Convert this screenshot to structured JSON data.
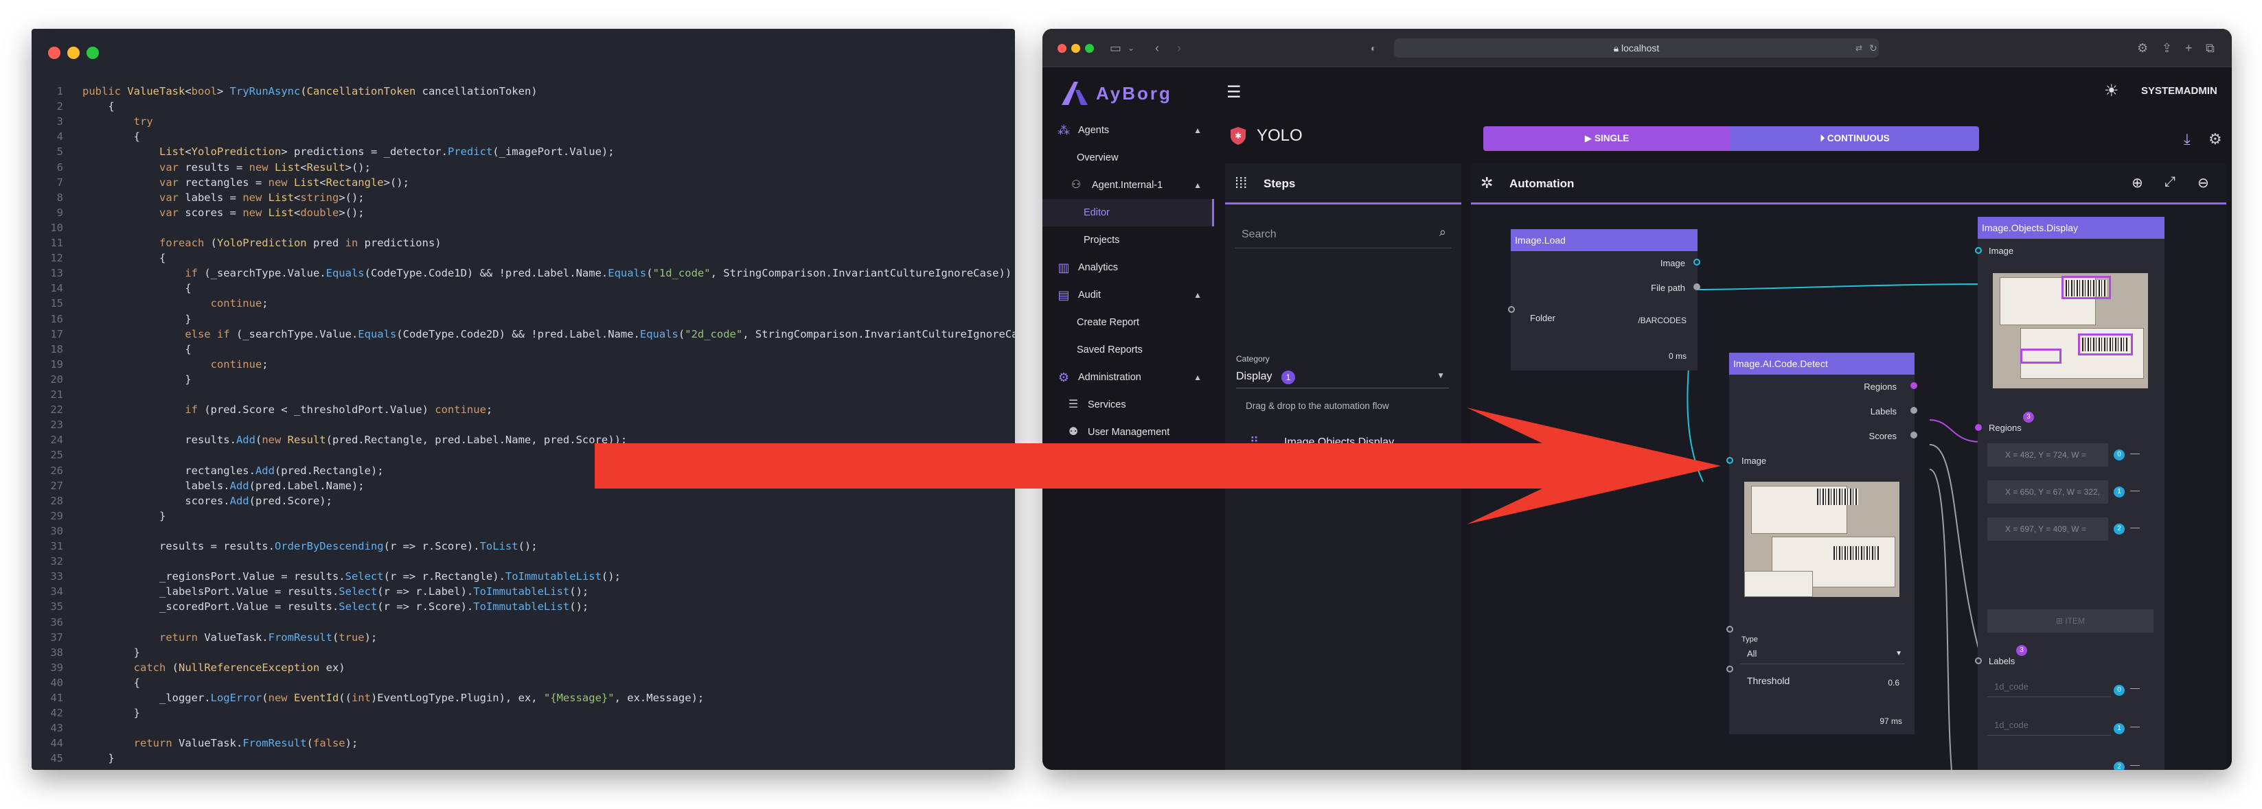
{
  "code": {
    "lines": [
      {
        "n": "1",
        "indent": 0,
        "parts": [
          [
            "kw",
            "public "
          ],
          [
            "ty",
            "ValueTask"
          ],
          [
            "tx",
            "<"
          ],
          [
            "kw",
            "bool"
          ],
          [
            "tx",
            "> "
          ],
          [
            "fn",
            "TryRunAsync"
          ],
          [
            "tx",
            "("
          ],
          [
            "ty",
            "CancellationToken"
          ],
          [
            "tx",
            " cancellationToken)"
          ]
        ]
      },
      {
        "n": "2",
        "indent": 1,
        "parts": [
          [
            "tx",
            "{"
          ]
        ]
      },
      {
        "n": "3",
        "indent": 2,
        "parts": [
          [
            "kw",
            "try"
          ]
        ]
      },
      {
        "n": "4",
        "indent": 2,
        "parts": [
          [
            "tx",
            "{"
          ]
        ]
      },
      {
        "n": "5",
        "indent": 3,
        "parts": [
          [
            "ty",
            "List"
          ],
          [
            "tx",
            "<"
          ],
          [
            "ty",
            "YoloPrediction"
          ],
          [
            "tx",
            "> predictions = _detector."
          ],
          [
            "fn",
            "Predict"
          ],
          [
            "tx",
            "(_imagePort.Value);"
          ]
        ]
      },
      {
        "n": "6",
        "indent": 3,
        "parts": [
          [
            "kw",
            "var"
          ],
          [
            "tx",
            " results = "
          ],
          [
            "kw",
            "new "
          ],
          [
            "ty",
            "List"
          ],
          [
            "tx",
            "<"
          ],
          [
            "ty",
            "Result"
          ],
          [
            "tx",
            ">();"
          ]
        ]
      },
      {
        "n": "7",
        "indent": 3,
        "parts": [
          [
            "kw",
            "var"
          ],
          [
            "tx",
            " rectangles = "
          ],
          [
            "kw",
            "new "
          ],
          [
            "ty",
            "List"
          ],
          [
            "tx",
            "<"
          ],
          [
            "ty",
            "Rectangle"
          ],
          [
            "tx",
            ">();"
          ]
        ]
      },
      {
        "n": "8",
        "indent": 3,
        "parts": [
          [
            "kw",
            "var"
          ],
          [
            "tx",
            " labels = "
          ],
          [
            "kw",
            "new "
          ],
          [
            "ty",
            "List"
          ],
          [
            "tx",
            "<"
          ],
          [
            "kw",
            "string"
          ],
          [
            "tx",
            ">();"
          ]
        ]
      },
      {
        "n": "9",
        "indent": 3,
        "parts": [
          [
            "kw",
            "var"
          ],
          [
            "tx",
            " scores = "
          ],
          [
            "kw",
            "new "
          ],
          [
            "ty",
            "List"
          ],
          [
            "tx",
            "<"
          ],
          [
            "kw",
            "double"
          ],
          [
            "tx",
            ">();"
          ]
        ]
      },
      {
        "n": "10",
        "indent": 0,
        "parts": []
      },
      {
        "n": "11",
        "indent": 3,
        "parts": [
          [
            "kw",
            "foreach"
          ],
          [
            "tx",
            " ("
          ],
          [
            "ty",
            "YoloPrediction"
          ],
          [
            "tx",
            " pred "
          ],
          [
            "kw",
            "in"
          ],
          [
            "tx",
            " predictions)"
          ]
        ]
      },
      {
        "n": "12",
        "indent": 3,
        "parts": [
          [
            "tx",
            "{"
          ]
        ]
      },
      {
        "n": "13",
        "indent": 4,
        "parts": [
          [
            "kw",
            "if"
          ],
          [
            "tx",
            " (_searchType.Value."
          ],
          [
            "fn",
            "Equals"
          ],
          [
            "tx",
            "(CodeType.Code1D) && !pred.Label.Name."
          ],
          [
            "fn",
            "Equals"
          ],
          [
            "tx",
            "("
          ],
          [
            "str",
            "\"1d_code\""
          ],
          [
            "tx",
            ", StringComparison.InvariantCultureIgnoreCase))"
          ]
        ]
      },
      {
        "n": "14",
        "indent": 4,
        "parts": [
          [
            "tx",
            "{"
          ]
        ]
      },
      {
        "n": "15",
        "indent": 5,
        "parts": [
          [
            "kw",
            "continue"
          ],
          [
            "tx",
            ";"
          ]
        ]
      },
      {
        "n": "16",
        "indent": 4,
        "parts": [
          [
            "tx",
            "}"
          ]
        ]
      },
      {
        "n": "17",
        "indent": 4,
        "parts": [
          [
            "kw",
            "else if"
          ],
          [
            "tx",
            " (_searchType.Value."
          ],
          [
            "fn",
            "Equals"
          ],
          [
            "tx",
            "(CodeType.Code2D) && !pred.Label.Name."
          ],
          [
            "fn",
            "Equals"
          ],
          [
            "tx",
            "("
          ],
          [
            "str",
            "\"2d_code\""
          ],
          [
            "tx",
            ", StringComparison.InvariantCultureIgnoreCase))"
          ]
        ]
      },
      {
        "n": "18",
        "indent": 4,
        "parts": [
          [
            "tx",
            "{"
          ]
        ]
      },
      {
        "n": "19",
        "indent": 5,
        "parts": [
          [
            "kw",
            "continue"
          ],
          [
            "tx",
            ";"
          ]
        ]
      },
      {
        "n": "20",
        "indent": 4,
        "parts": [
          [
            "tx",
            "}"
          ]
        ]
      },
      {
        "n": "21",
        "indent": 0,
        "parts": []
      },
      {
        "n": "22",
        "indent": 4,
        "parts": [
          [
            "kw",
            "if"
          ],
          [
            "tx",
            " (pred.Score < _thresholdPort.Value) "
          ],
          [
            "kw",
            "continue"
          ],
          [
            "tx",
            ";"
          ]
        ]
      },
      {
        "n": "23",
        "indent": 0,
        "parts": []
      },
      {
        "n": "24",
        "indent": 4,
        "parts": [
          [
            "tx",
            "results."
          ],
          [
            "fn",
            "Add"
          ],
          [
            "tx",
            "("
          ],
          [
            "kw",
            "new "
          ],
          [
            "ty",
            "Result"
          ],
          [
            "tx",
            "(pred.Rectangle, pred.Label.Name, pred.Score));"
          ]
        ]
      },
      {
        "n": "25",
        "indent": 0,
        "parts": []
      },
      {
        "n": "26",
        "indent": 4,
        "parts": [
          [
            "tx",
            "rectangles."
          ],
          [
            "fn",
            "Add"
          ],
          [
            "tx",
            "(pred.Rectangle);"
          ]
        ]
      },
      {
        "n": "27",
        "indent": 4,
        "parts": [
          [
            "tx",
            "labels."
          ],
          [
            "fn",
            "Add"
          ],
          [
            "tx",
            "(pred.Label.Name);"
          ]
        ]
      },
      {
        "n": "28",
        "indent": 4,
        "parts": [
          [
            "tx",
            "scores."
          ],
          [
            "fn",
            "Add"
          ],
          [
            "tx",
            "(pred.Score);"
          ]
        ]
      },
      {
        "n": "29",
        "indent": 3,
        "parts": [
          [
            "tx",
            "}"
          ]
        ]
      },
      {
        "n": "30",
        "indent": 0,
        "parts": []
      },
      {
        "n": "31",
        "indent": 3,
        "parts": [
          [
            "tx",
            "results = results."
          ],
          [
            "fn",
            "OrderByDescending"
          ],
          [
            "tx",
            "(r => r.Score)."
          ],
          [
            "fn",
            "ToList"
          ],
          [
            "tx",
            "();"
          ]
        ]
      },
      {
        "n": "32",
        "indent": 0,
        "parts": []
      },
      {
        "n": "33",
        "indent": 3,
        "parts": [
          [
            "tx",
            "_regionsPort.Value = results."
          ],
          [
            "fn",
            "Select"
          ],
          [
            "tx",
            "(r => r.Rectangle)."
          ],
          [
            "fn",
            "ToImmutableList"
          ],
          [
            "tx",
            "();"
          ]
        ]
      },
      {
        "n": "34",
        "indent": 3,
        "parts": [
          [
            "tx",
            "_labelsPort.Value = results."
          ],
          [
            "fn",
            "Select"
          ],
          [
            "tx",
            "(r => r.Label)."
          ],
          [
            "fn",
            "ToImmutableList"
          ],
          [
            "tx",
            "();"
          ]
        ]
      },
      {
        "n": "35",
        "indent": 3,
        "parts": [
          [
            "tx",
            "_scoredPort.Value = results."
          ],
          [
            "fn",
            "Select"
          ],
          [
            "tx",
            "(r => r.Score)."
          ],
          [
            "fn",
            "ToImmutableList"
          ],
          [
            "tx",
            "();"
          ]
        ]
      },
      {
        "n": "36",
        "indent": 0,
        "parts": []
      },
      {
        "n": "37",
        "indent": 3,
        "parts": [
          [
            "kw",
            "return"
          ],
          [
            "tx",
            " ValueTask."
          ],
          [
            "fn",
            "FromResult"
          ],
          [
            "tx",
            "("
          ],
          [
            "kw",
            "true"
          ],
          [
            "tx",
            ");"
          ]
        ]
      },
      {
        "n": "38",
        "indent": 2,
        "parts": [
          [
            "tx",
            "}"
          ]
        ]
      },
      {
        "n": "39",
        "indent": 2,
        "parts": [
          [
            "kw",
            "catch"
          ],
          [
            "tx",
            " ("
          ],
          [
            "ty",
            "NullReferenceException"
          ],
          [
            "tx",
            " ex)"
          ]
        ]
      },
      {
        "n": "40",
        "indent": 2,
        "parts": [
          [
            "tx",
            "{"
          ]
        ]
      },
      {
        "n": "41",
        "indent": 3,
        "parts": [
          [
            "tx",
            "_logger."
          ],
          [
            "fn",
            "LogError"
          ],
          [
            "tx",
            "("
          ],
          [
            "kw",
            "new "
          ],
          [
            "ty",
            "EventId"
          ],
          [
            "tx",
            "(("
          ],
          [
            "kw",
            "int"
          ],
          [
            "tx",
            ")EventLogType.Plugin), ex, "
          ],
          [
            "str",
            "\"{Message}\""
          ],
          [
            "tx",
            ", ex.Message);"
          ]
        ]
      },
      {
        "n": "42",
        "indent": 2,
        "parts": [
          [
            "tx",
            "}"
          ]
        ]
      },
      {
        "n": "43",
        "indent": 0,
        "parts": []
      },
      {
        "n": "44",
        "indent": 2,
        "parts": [
          [
            "kw",
            "return"
          ],
          [
            "tx",
            " ValueTask."
          ],
          [
            "fn",
            "FromResult"
          ],
          [
            "tx",
            "("
          ],
          [
            "kw",
            "false"
          ],
          [
            "tx",
            ");"
          ]
        ]
      },
      {
        "n": "45",
        "indent": 1,
        "parts": [
          [
            "tx",
            "}"
          ]
        ]
      }
    ]
  },
  "browser": {
    "url": "localhost"
  },
  "app": {
    "brand": "AyBorg",
    "user": "SYSTEMADMIN",
    "accent": "#8e6bf0",
    "sidebar": {
      "agents": "Agents",
      "overview": "Overview",
      "agent_internal": "Agent.Internal-1",
      "editor": "Editor",
      "projects": "Projects",
      "analytics": "Analytics",
      "audit": "Audit",
      "create_report": "Create Report",
      "saved_reports": "Saved Reports",
      "administration": "Administration",
      "services": "Services",
      "user_management": "User Management"
    },
    "page_title": "YOLO",
    "modes": {
      "single": "SINGLE",
      "continuous": "CONTINUOUS"
    },
    "steps": {
      "title": "Steps",
      "search_placeholder": "Search",
      "category_label": "Category",
      "category_value": "Display",
      "category_count": "1",
      "hint": "Drag & drop to the automation flow",
      "items": [
        "Image.Objects.Display"
      ]
    },
    "automation": {
      "title": "Automation",
      "nodes": {
        "load": {
          "title": "Image.Load",
          "image": "Image",
          "file_path": "File path",
          "folder": "Folder",
          "folder_value": "/BARCODES",
          "time": "0 ms"
        },
        "detect": {
          "title": "Image.AI.Code.Detect",
          "regions": "Regions",
          "labels": "Labels",
          "scores": "Scores",
          "image": "Image",
          "type_label": "Type",
          "type_value": "All",
          "threshold_label": "Threshold",
          "threshold_value": "0.6",
          "time": "97 ms"
        },
        "display": {
          "title": "Image.Objects.Display",
          "image": "Image",
          "regions": "Regions",
          "regions_count": "3",
          "region_values": [
            "X = 482, Y = 724, W =",
            "X = 650, Y = 67, W = 322,",
            "X = 697, Y = 409, W ="
          ],
          "region_indices": [
            "0",
            "1",
            "2"
          ],
          "item_button": "ITEM",
          "labels": "Labels",
          "labels_count": "3",
          "label_values": [
            "1d_code",
            "1d_code"
          ],
          "label_indices": [
            "0",
            "1",
            "2"
          ]
        }
      }
    }
  }
}
